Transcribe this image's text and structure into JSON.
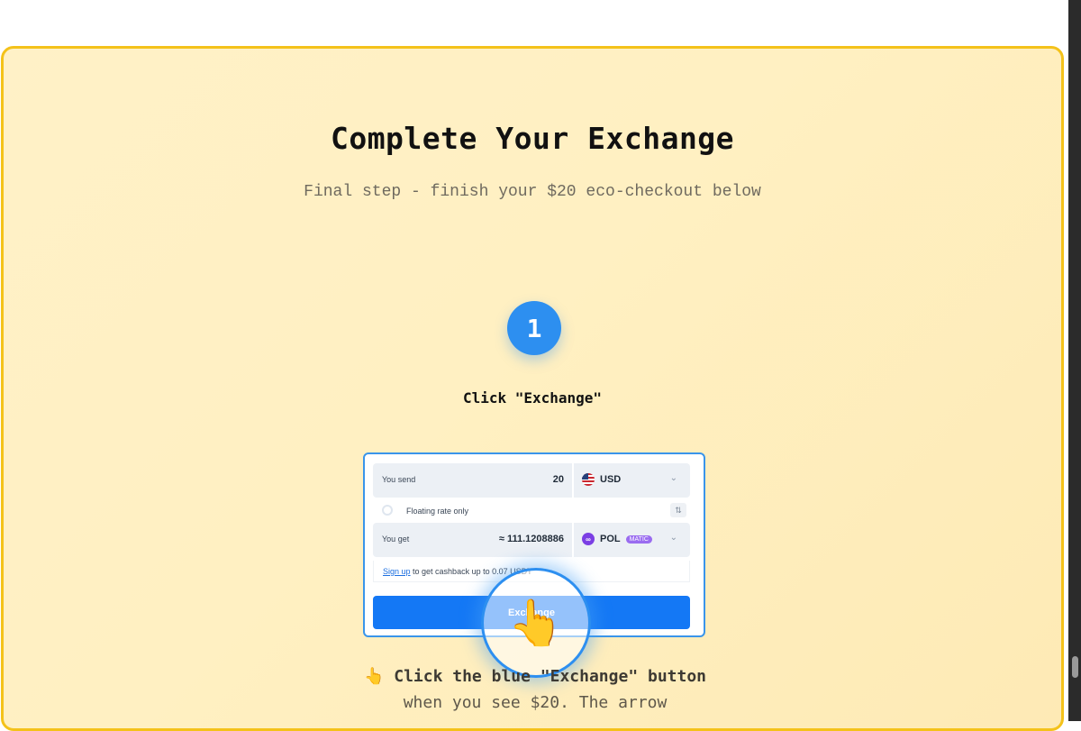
{
  "page": {
    "title": "Complete Your Exchange",
    "subtitle": "Final step - finish your $20 eco-checkout below"
  },
  "step": {
    "number": "1",
    "label": "Click \"Exchange\""
  },
  "widget": {
    "send_label": "You send",
    "send_amount": "20",
    "send_currency": "USD",
    "floating_label": "Floating rate only",
    "get_label": "You get",
    "get_amount": "≈ 111.1208886",
    "get_currency": "POL",
    "get_network": "MATIC",
    "signup_link": "Sign up",
    "signup_text": " to get cashback up to 0.07 USDT",
    "exchange_button": "Exchange"
  },
  "hint": {
    "pointer": "👆",
    "bold_text": "Click the blue \"Exchange\" button",
    "rest_text": " when you see $20. The arrow"
  },
  "icons": {
    "pointer_hand": "👆"
  },
  "colors": {
    "accent": "#2d8ff0",
    "card_border": "#f4c21a",
    "card_bg": "#fff1c7",
    "exchange_button": "#1478f5"
  }
}
